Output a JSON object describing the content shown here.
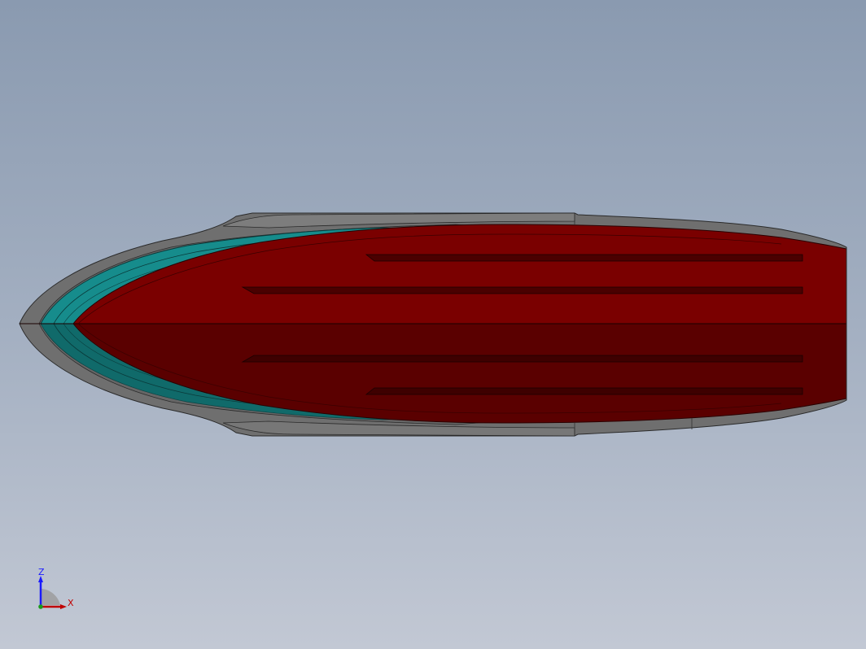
{
  "viewport": {
    "background_top": "#8a9ab0",
    "background_bottom": "#c2c8d4"
  },
  "model": {
    "parts": [
      {
        "name": "hull-outer-shell",
        "color": "#6e6e6e"
      },
      {
        "name": "hull-teal-layer",
        "color": "#1a8a8a"
      },
      {
        "name": "hull-deck-red",
        "color": "#7a0000"
      }
    ]
  },
  "triad": {
    "z_label": "Z",
    "x_label": "X",
    "z_color": "#1a1aff",
    "x_color": "#c00000"
  }
}
